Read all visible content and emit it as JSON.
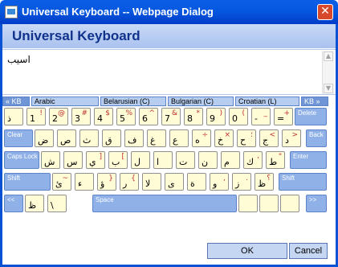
{
  "window": {
    "title": "Universal Keyboard -- Webpage Dialog",
    "close_glyph": "✕"
  },
  "header": {
    "title": "Universal Keyboard"
  },
  "textarea": {
    "value": "اسيب"
  },
  "languages": {
    "prev": "« KB",
    "items": [
      "Arabic",
      "Belarusian (C)",
      "Bulgarian (C)",
      "Croatian (L)"
    ],
    "next": "KB »"
  },
  "rows": [
    [
      {
        "m": "ذ",
        "s": ""
      },
      {
        "m": "1",
        "s": "!"
      },
      {
        "m": "2",
        "s": "@"
      },
      {
        "m": "3",
        "s": "#"
      },
      {
        "m": "4",
        "s": "$"
      },
      {
        "m": "5",
        "s": "%"
      },
      {
        "m": "6",
        "s": "^"
      },
      {
        "m": "7",
        "s": "&"
      },
      {
        "m": "8",
        "s": "*"
      },
      {
        "m": "9",
        "s": ")"
      },
      {
        "m": "0",
        "s": "("
      },
      {
        "m": "-",
        "s": "_"
      },
      {
        "m": "=",
        "s": "+"
      }
    ],
    [
      {
        "m": "ض",
        "s": ""
      },
      {
        "m": "ص",
        "s": ""
      },
      {
        "m": "ث",
        "s": ""
      },
      {
        "m": "ق",
        "s": ""
      },
      {
        "m": "ف",
        "s": ""
      },
      {
        "m": "غ",
        "s": ""
      },
      {
        "m": "ع",
        "s": ""
      },
      {
        "m": "ه",
        "s": "÷"
      },
      {
        "m": "خ",
        "s": "×"
      },
      {
        "m": "ح",
        "s": "؛"
      },
      {
        "m": "ج",
        "s": "<"
      },
      {
        "m": "د",
        "s": ">"
      }
    ],
    [
      {
        "m": "ش",
        "s": ""
      },
      {
        "m": "س",
        "s": ""
      },
      {
        "m": "ي",
        "s": "]"
      },
      {
        "m": "ب",
        "s": "["
      },
      {
        "m": "ل",
        "s": ""
      },
      {
        "m": "ا",
        "s": ""
      },
      {
        "m": "ت",
        "s": ""
      },
      {
        "m": "ن",
        "s": ""
      },
      {
        "m": "م",
        "s": ""
      },
      {
        "m": "ك",
        "s": "،"
      },
      {
        "m": "ط",
        "s": "\""
      }
    ],
    [
      {
        "m": "ئ",
        "s": "~"
      },
      {
        "m": "ء",
        "s": ""
      },
      {
        "m": "ؤ",
        "s": "}"
      },
      {
        "m": "ر",
        "s": "{"
      },
      {
        "m": "لا",
        "s": ""
      },
      {
        "m": "ى",
        "s": ""
      },
      {
        "m": "ة",
        "s": ""
      },
      {
        "m": "و",
        "s": ","
      },
      {
        "m": "ز",
        "s": "."
      },
      {
        "m": "ظ",
        "s": "؟"
      }
    ],
    [
      {
        "m": "ظ",
        "s": ""
      },
      {
        "m": "\\",
        "s": ""
      }
    ]
  ],
  "fn": {
    "delete": "Delete",
    "clear": "Clear",
    "back": "Back",
    "caps": "Caps Lock",
    "enter": "Enter",
    "shift": "Shift",
    "prev": "<<",
    "space": "Space",
    "next": ">>"
  },
  "footer": {
    "ok": "OK",
    "cancel": "Cancel"
  }
}
